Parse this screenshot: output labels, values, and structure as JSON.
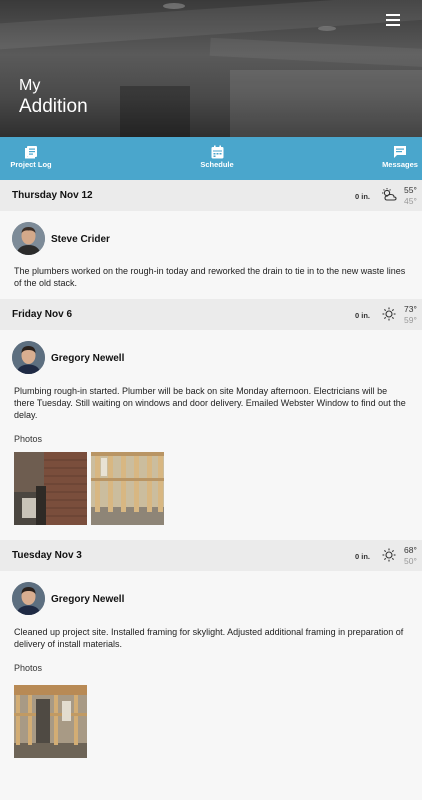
{
  "app": {
    "title_line1": "My",
    "title_line2": "Addition"
  },
  "tabs": [
    {
      "label": "Project Log",
      "icon": "journal-icon"
    },
    {
      "label": "Schedule",
      "icon": "calendar-icon"
    },
    {
      "label": "Messages",
      "icon": "message-icon"
    }
  ],
  "entries": [
    {
      "date": "Thursday Nov 12",
      "rain": "0 in.",
      "weather_icon": "partly-cloudy-icon",
      "high": "55°",
      "low": "45°",
      "author": "Steve Crider",
      "text": "The plumbers worked on the rough-in today and reworked the drain to tie in to the new waste lines of the old stack."
    },
    {
      "date": "Friday Nov 6",
      "rain": "0 in.",
      "weather_icon": "sunny-icon",
      "high": "73°",
      "low": "59°",
      "author": "Gregory Newell",
      "text": "Plumbing rough-in started. Plumber will be back on site Monday afternoon. Electricians will be there Tuesday. Still waiting on windows and door delivery. Emailed Webster Window to find out the delay.",
      "photos_label": "Photos"
    },
    {
      "date": "Tuesday Nov 3",
      "rain": "0 in.",
      "weather_icon": "sunny-icon",
      "high": "68°",
      "low": "50°",
      "author": "Gregory Newell",
      "text": "Cleaned up project site. Installed framing for skylight. Adjusted additional framing in preparation of delivery of install materials.",
      "photos_label": "Photos"
    }
  ],
  "colors": {
    "tabbar": "#4aa6cc",
    "day_header": "#ebebeb",
    "background": "#f7f7f7"
  }
}
